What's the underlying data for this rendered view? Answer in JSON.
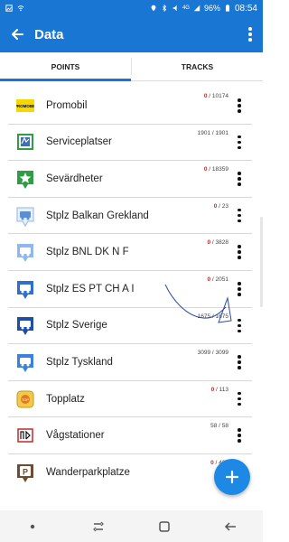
{
  "status_bar": {
    "battery": "96%",
    "time": "08:54",
    "network": "4G"
  },
  "app_bar": {
    "title": "Data"
  },
  "tabs": [
    {
      "label": "POINTS",
      "active": true
    },
    {
      "label": "TRACKS",
      "active": false
    }
  ],
  "rows": [
    {
      "label": "Promobil",
      "count_used": "0",
      "count_total": "10174",
      "icon": "promobil-logo-icon"
    },
    {
      "label": "Serviceplatser",
      "count_used": "1901",
      "count_total": "1901",
      "icon": "service-icon"
    },
    {
      "label": "Sevärdheter",
      "count_used": "0",
      "count_total": "18359",
      "icon": "star-marker-icon"
    },
    {
      "label": "Stplz Balkan Grekland",
      "count_used": "0",
      "count_total": "23",
      "icon": "camper-marker-icon"
    },
    {
      "label": "Stplz BNL DK N F",
      "count_used": "0",
      "count_total": "3828",
      "icon": "camper-marker-icon"
    },
    {
      "label": "Stplz ES PT CH A I",
      "count_used": "0",
      "count_total": "2051",
      "icon": "camper-marker-icon"
    },
    {
      "label": "Stplz Sverige",
      "count_used": "1675",
      "count_total": "1675",
      "icon": "camper-marker-icon"
    },
    {
      "label": "Stplz Tyskland",
      "count_used": "3099",
      "count_total": "3099",
      "icon": "camper-marker-icon"
    },
    {
      "label": "Topplatz",
      "count_used": "0",
      "count_total": "113",
      "icon": "topplatz-logo-icon"
    },
    {
      "label": "Vågstationer",
      "count_used": "58",
      "count_total": "58",
      "icon": "scale-icon"
    },
    {
      "label": "Wanderparkplatze",
      "count_used": "0",
      "count_total": "437",
      "icon": "parking-marker-icon"
    }
  ],
  "colors": {
    "primary": "#1976d2",
    "fab": "#1e88e5",
    "count_zero": "#c62828"
  }
}
